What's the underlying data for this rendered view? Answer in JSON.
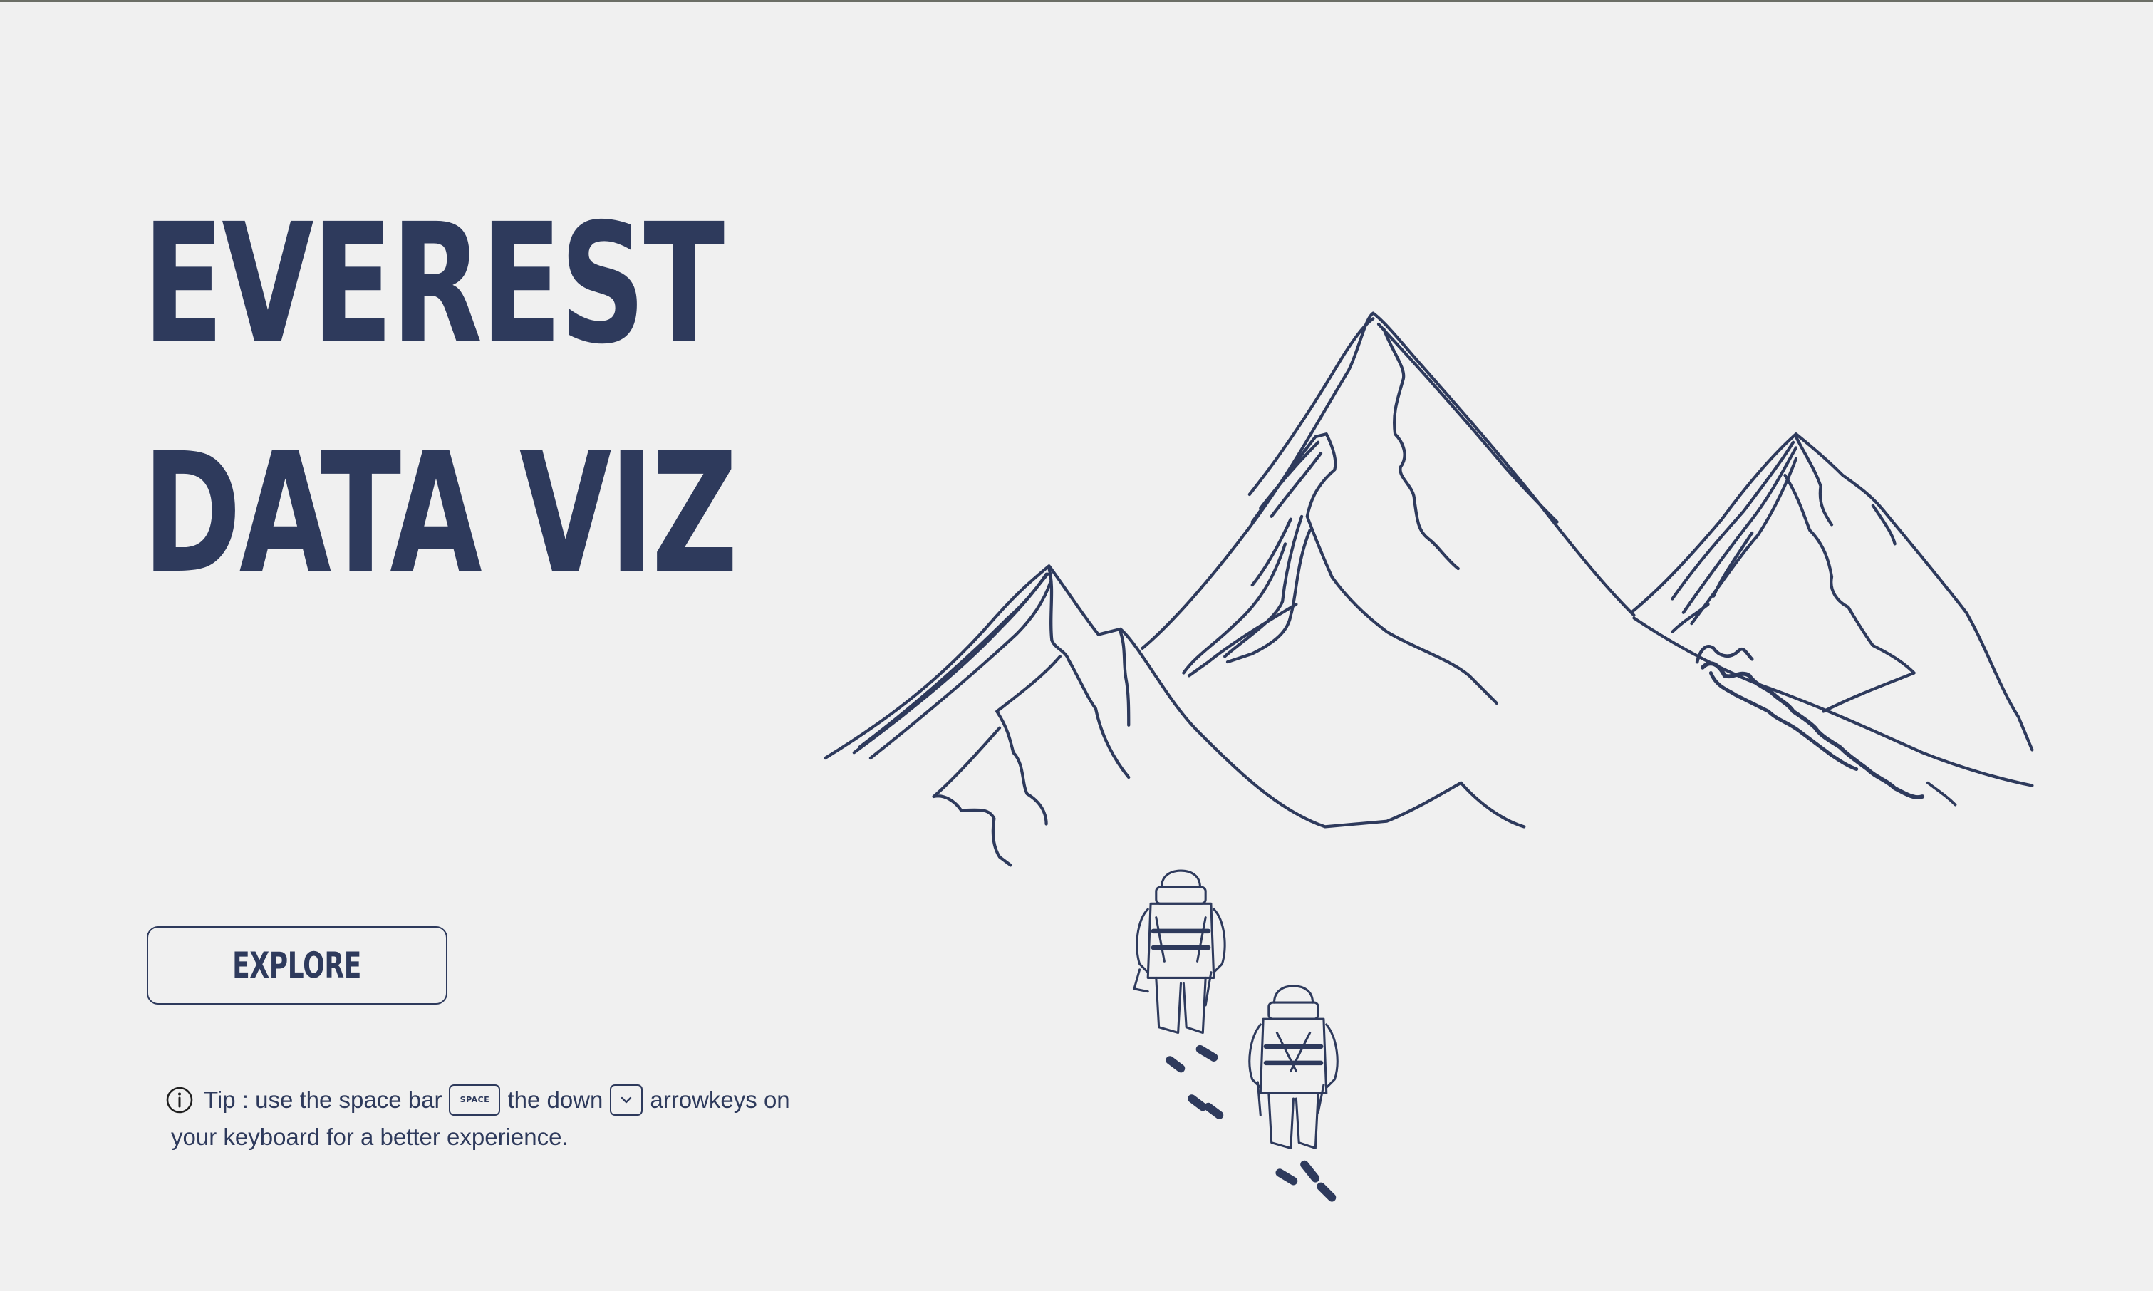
{
  "hero": {
    "title_line1": "EVEREST",
    "title_line2": "DATA VIZ"
  },
  "explore_button": {
    "label": "EXPLORE"
  },
  "tip": {
    "icon": "info-icon",
    "prefix": "Tip : use the space bar",
    "space_key_label": "SPACE",
    "middle": "the down",
    "down_key_icon": "chevron-down-icon",
    "suffix": "arrowkeys on",
    "line2": "your keyboard for a better experience."
  },
  "illustration": {
    "icon": "mountains-climbers-illustration"
  },
  "colors": {
    "background": "#f0f0f0",
    "ink": "#2e3a5c"
  }
}
